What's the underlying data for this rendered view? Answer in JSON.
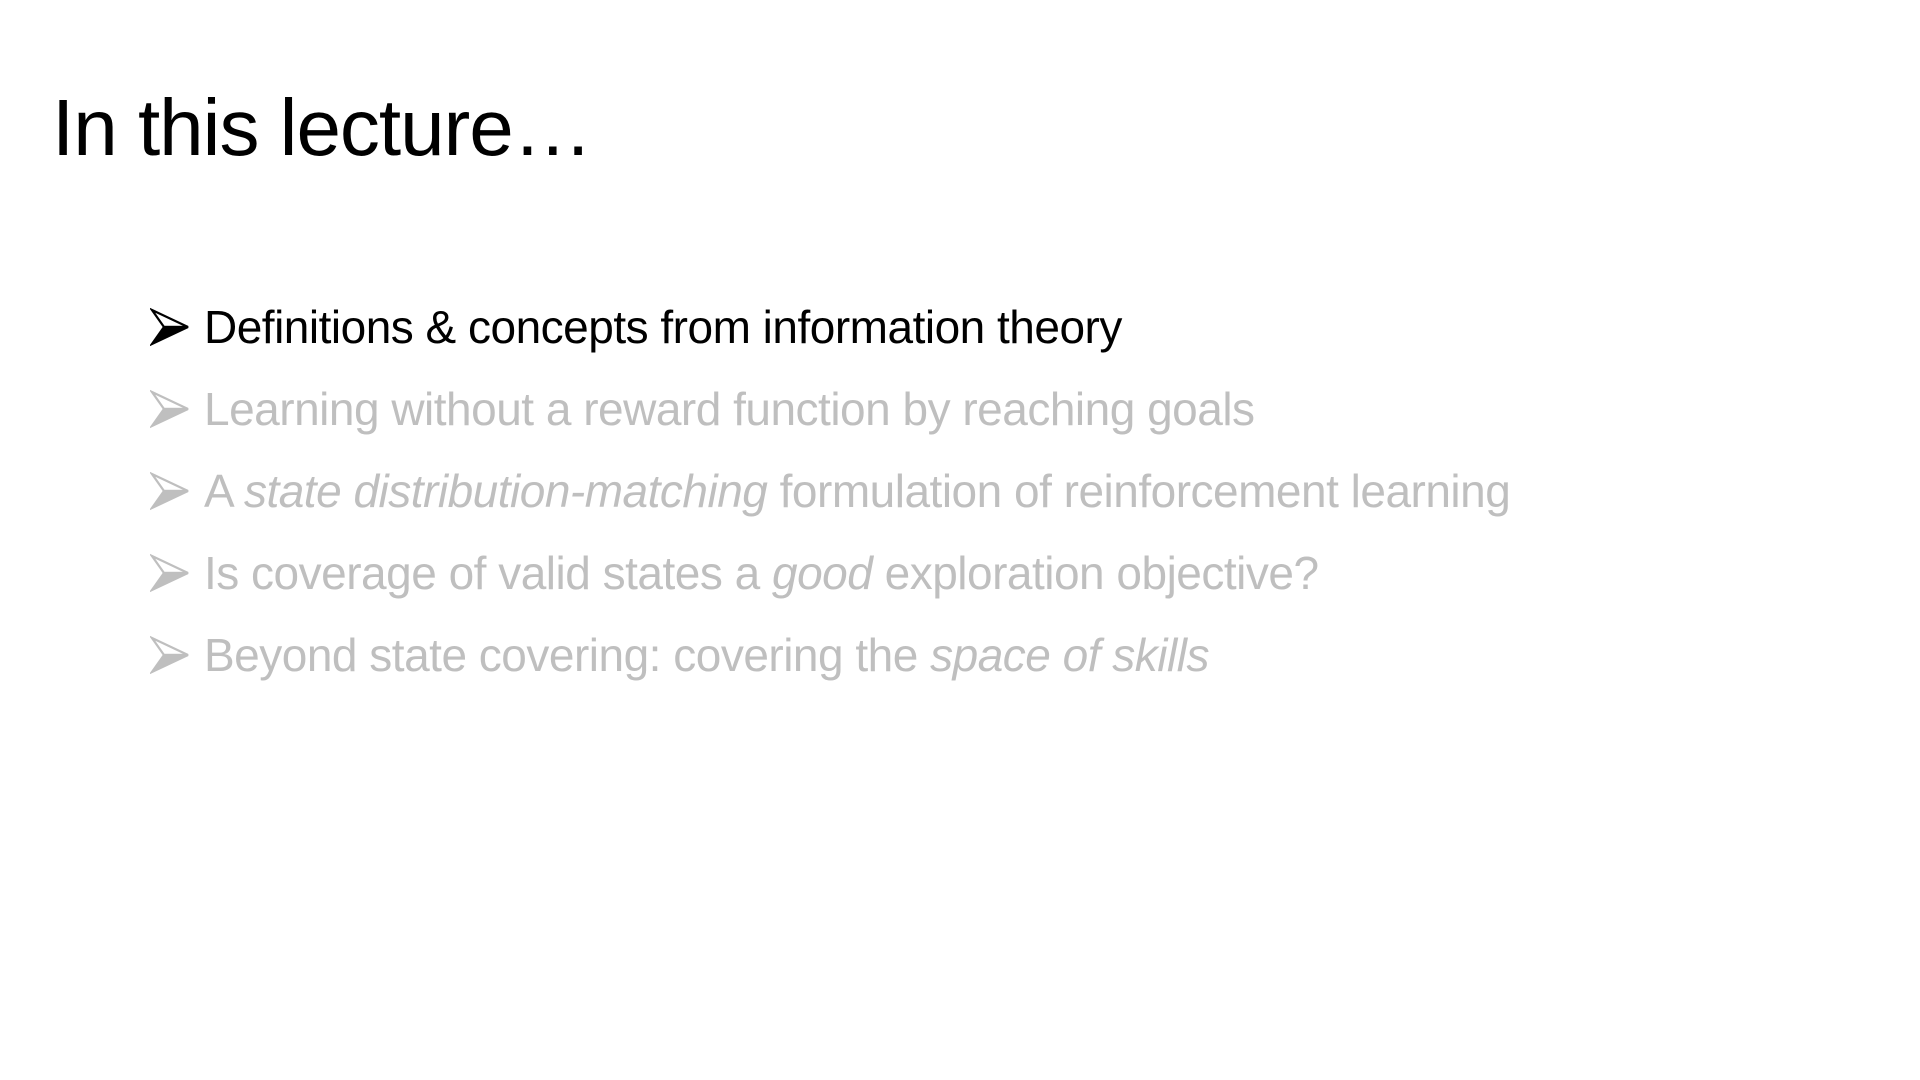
{
  "slide": {
    "title": "In this lecture…",
    "colors": {
      "active": "#000000",
      "inactive": "#bfbfbf"
    },
    "bullet_icon": "arrowhead-bullet-icon",
    "bullets": [
      {
        "active": true,
        "parts": [
          {
            "text": "Definitions & concepts from information theory",
            "italic": false
          }
        ]
      },
      {
        "active": false,
        "parts": [
          {
            "text": "Learning without a reward function by reaching goals",
            "italic": false
          }
        ]
      },
      {
        "active": false,
        "parts": [
          {
            "text": "A ",
            "italic": false
          },
          {
            "text": "state distribution-matching",
            "italic": true
          },
          {
            "text": " formulation of reinforcement learning",
            "italic": false
          }
        ]
      },
      {
        "active": false,
        "parts": [
          {
            "text": "Is coverage of valid states a ",
            "italic": false
          },
          {
            "text": "good",
            "italic": true
          },
          {
            "text": " exploration objective?",
            "italic": false
          }
        ]
      },
      {
        "active": false,
        "parts": [
          {
            "text": "Beyond state covering: covering the ",
            "italic": false
          },
          {
            "text": "space of skills",
            "italic": true
          }
        ]
      }
    ]
  }
}
